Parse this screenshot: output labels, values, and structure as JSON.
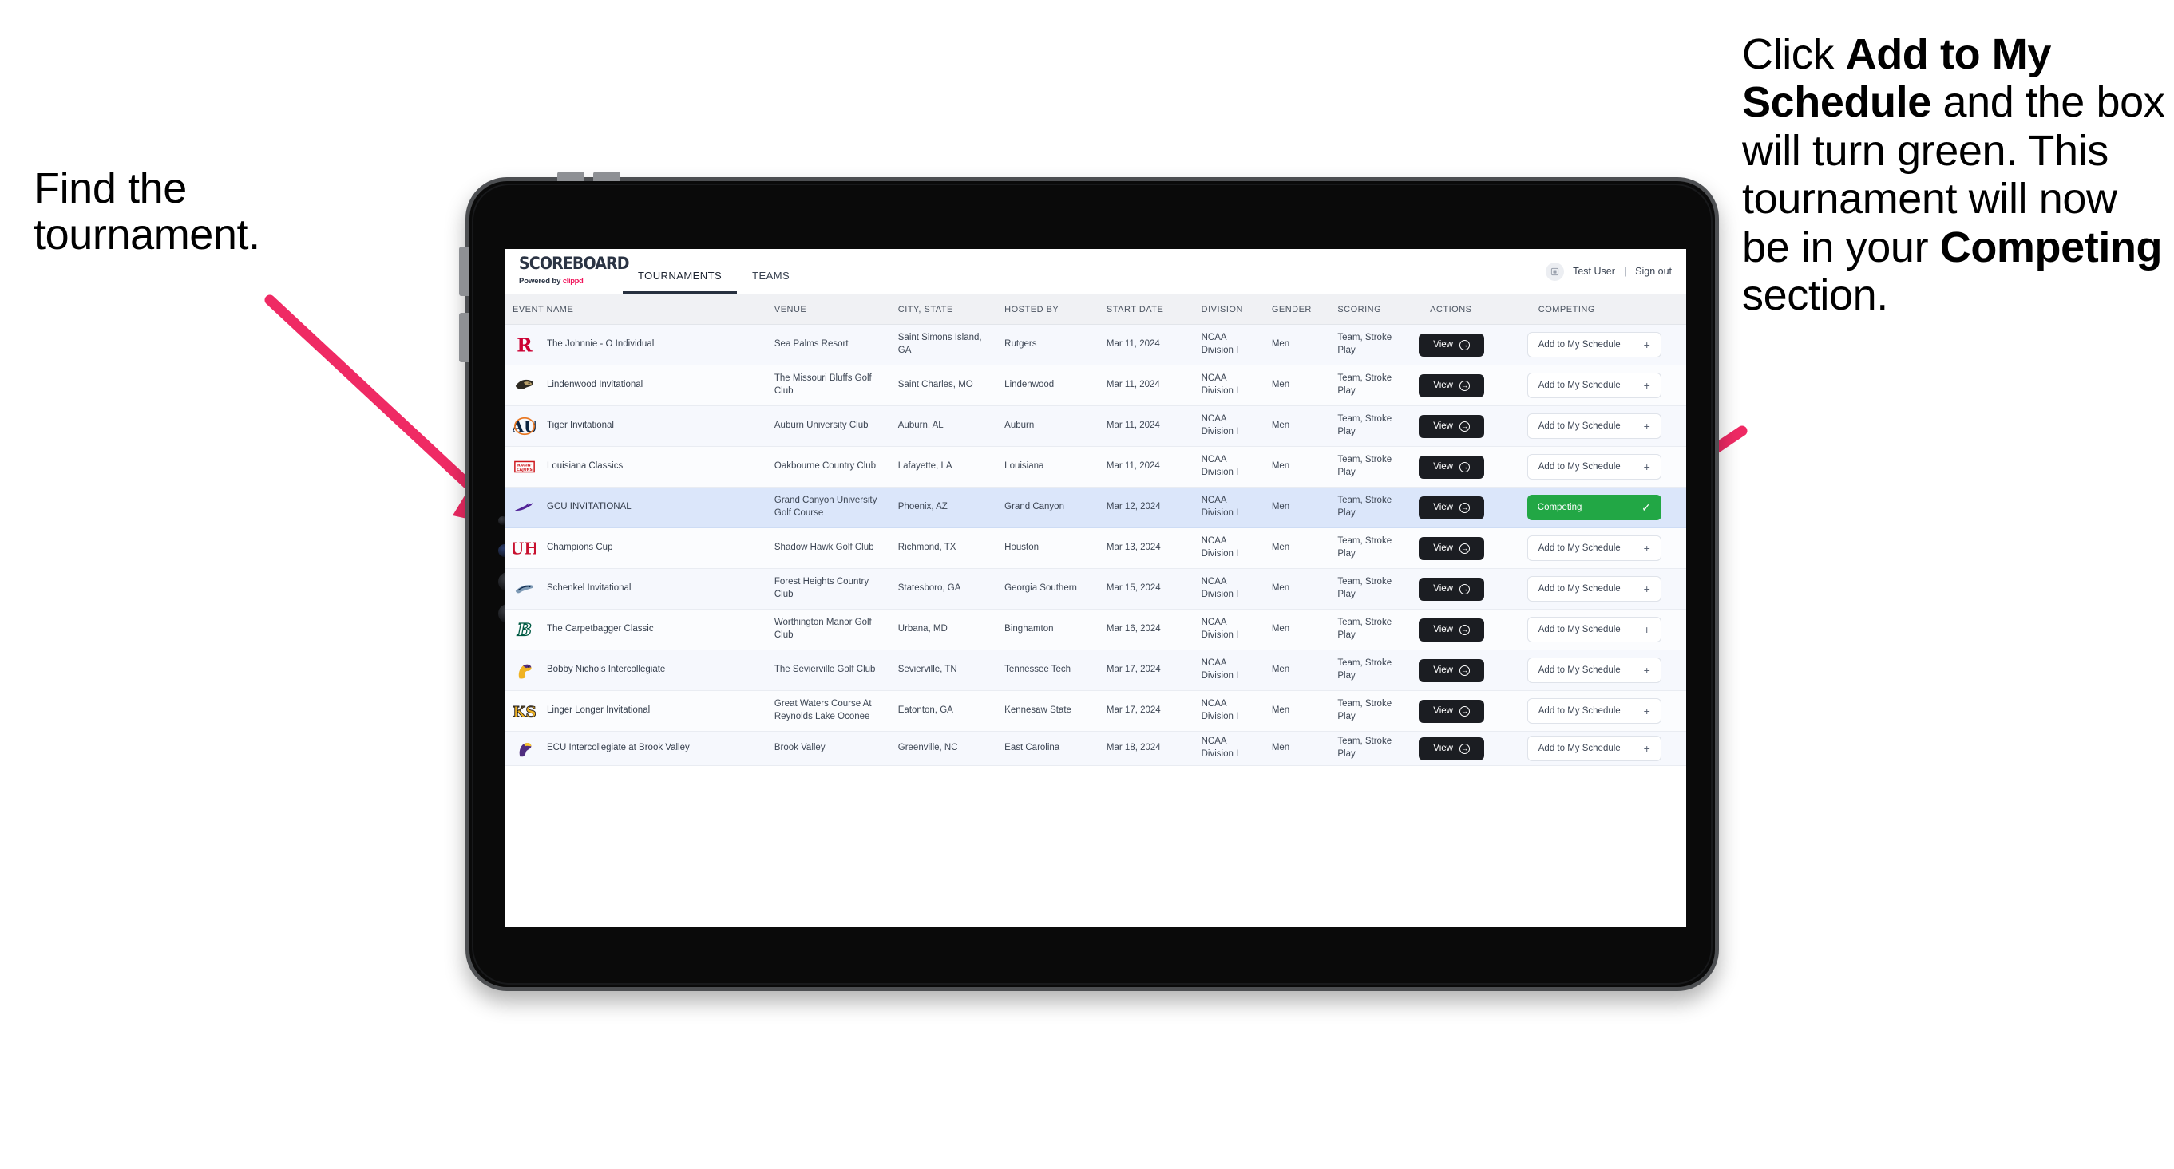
{
  "annotations": {
    "left": "Find the tournament.",
    "right_parts": [
      {
        "t": "Click ",
        "b": false
      },
      {
        "t": "Add to My Schedule",
        "b": true
      },
      {
        "t": " and the box will turn green. This tournament will now be in your ",
        "b": false
      },
      {
        "t": "Competing",
        "b": true
      },
      {
        "t": " section.",
        "b": false
      }
    ],
    "arrow_color": "#ef2a64"
  },
  "app": {
    "brand": {
      "title": "SCOREBOARD",
      "powered_prefix": "Powered by ",
      "powered_brand": "clippd"
    },
    "nav": [
      {
        "label": "TOURNAMENTS",
        "active": true
      },
      {
        "label": "TEAMS",
        "active": false
      }
    ],
    "header_right": {
      "avatar_icon": "user-avatar-icon",
      "user_name": "Test User",
      "separator": "|",
      "sign_out": "Sign out"
    },
    "table": {
      "columns": [
        "EVENT NAME",
        "VENUE",
        "CITY, STATE",
        "HOSTED BY",
        "START DATE",
        "DIVISION",
        "GENDER",
        "SCORING",
        "ACTIONS",
        "COMPETING"
      ],
      "view_label": "View",
      "add_label": "Add to My Schedule",
      "add_icon": "plus-icon",
      "competing_label": "Competing",
      "competing_icon": "check-icon",
      "competing_color": "#22a745",
      "selected_row_color": "#dbe6fa",
      "rows": [
        {
          "logo": "rutgers-r-logo",
          "event": "The Johnnie - O Individual",
          "venue": "Sea Palms Resort",
          "city": "Saint Simons Island, GA",
          "host": "Rutgers",
          "start": "Mar 11, 2024",
          "division": "NCAA Division I",
          "gender": "Men",
          "scoring": "Team, Stroke Play",
          "competing": false
        },
        {
          "logo": "lindenwood-lion-logo",
          "event": "Lindenwood Invitational",
          "venue": "The Missouri Bluffs Golf Club",
          "city": "Saint Charles, MO",
          "host": "Lindenwood",
          "start": "Mar 11, 2024",
          "division": "NCAA Division I",
          "gender": "Men",
          "scoring": "Team, Stroke Play",
          "competing": false
        },
        {
          "logo": "auburn-au-logo",
          "event": "Tiger Invitational",
          "venue": "Auburn University Club",
          "city": "Auburn, AL",
          "host": "Auburn",
          "start": "Mar 11, 2024",
          "division": "NCAA Division I",
          "gender": "Men",
          "scoring": "Team, Stroke Play",
          "competing": false
        },
        {
          "logo": "louisiana-ragin-cajuns-logo",
          "event": "Louisiana Classics",
          "venue": "Oakbourne Country Club",
          "city": "Lafayette, LA",
          "host": "Louisiana",
          "start": "Mar 11, 2024",
          "division": "NCAA Division I",
          "gender": "Men",
          "scoring": "Team, Stroke Play",
          "competing": false
        },
        {
          "logo": "grand-canyon-lope-logo",
          "event": "GCU INVITATIONAL",
          "venue": "Grand Canyon University Golf Course",
          "city": "Phoenix, AZ",
          "host": "Grand Canyon",
          "start": "Mar 12, 2024",
          "division": "NCAA Division I",
          "gender": "Men",
          "scoring": "Team, Stroke Play",
          "competing": true
        },
        {
          "logo": "houston-uh-logo",
          "event": "Champions Cup",
          "venue": "Shadow Hawk Golf Club",
          "city": "Richmond, TX",
          "host": "Houston",
          "start": "Mar 13, 2024",
          "division": "NCAA Division I",
          "gender": "Men",
          "scoring": "Team, Stroke Play",
          "competing": false
        },
        {
          "logo": "georgia-southern-eagle-logo",
          "event": "Schenkel Invitational",
          "venue": "Forest Heights Country Club",
          "city": "Statesboro, GA",
          "host": "Georgia Southern",
          "start": "Mar 15, 2024",
          "division": "NCAA Division I",
          "gender": "Men",
          "scoring": "Team, Stroke Play",
          "competing": false
        },
        {
          "logo": "binghamton-b-logo",
          "event": "The Carpetbagger Classic",
          "venue": "Worthington Manor Golf Club",
          "city": "Urbana, MD",
          "host": "Binghamton",
          "start": "Mar 16, 2024",
          "division": "NCAA Division I",
          "gender": "Men",
          "scoring": "Team, Stroke Play",
          "competing": false
        },
        {
          "logo": "tennessee-tech-eagle-logo",
          "event": "Bobby Nichols Intercollegiate",
          "venue": "The Sevierville Golf Club",
          "city": "Sevierville, TN",
          "host": "Tennessee Tech",
          "start": "Mar 17, 2024",
          "division": "NCAA Division I",
          "gender": "Men",
          "scoring": "Team, Stroke Play",
          "competing": false
        },
        {
          "logo": "kennesaw-state-ks-logo",
          "event": "Linger Longer Invitational",
          "venue": "Great Waters Course At Reynolds Lake Oconee",
          "city": "Eatonton, GA",
          "host": "Kennesaw State",
          "start": "Mar 17, 2024",
          "division": "NCAA Division I",
          "gender": "Men",
          "scoring": "Team, Stroke Play",
          "competing": false
        },
        {
          "logo": "east-carolina-logo",
          "event": "ECU Intercollegiate at Brook Valley",
          "venue": "Brook Valley",
          "city": "Greenville, NC",
          "host": "East Carolina",
          "start": "Mar 18, 2024",
          "division": "NCAA Division I",
          "gender": "Men",
          "scoring": "Team, Stroke Play",
          "competing": false,
          "clipped": true
        }
      ]
    }
  }
}
